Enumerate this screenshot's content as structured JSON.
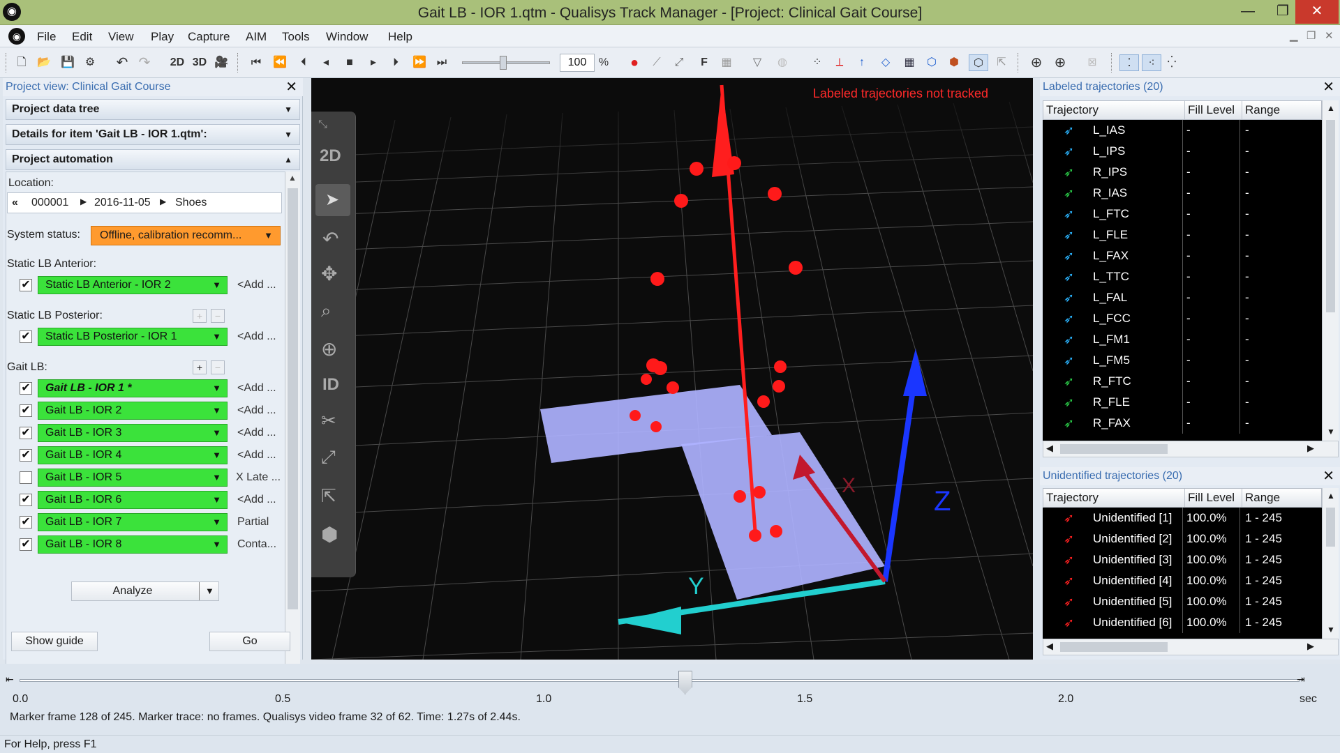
{
  "window": {
    "title": "Gait LB - IOR 1.qtm - Qualisys Track Manager - [Project: Clinical Gait Course]",
    "minimize": "—",
    "restore": "❐",
    "close": "✕"
  },
  "menu": [
    "File",
    "Edit",
    "View",
    "Play",
    "Capture",
    "AIM",
    "Tools",
    "Window",
    "Help"
  ],
  "toolbar": {
    "speed_value": "100",
    "speed_unit": "%",
    "btn_2d": "2D",
    "btn_3d": "3D",
    "icons": [
      "new-file-icon",
      "open-folder-icon",
      "save-icon",
      "settings-icon",
      "undo-icon",
      "redo-icon"
    ]
  },
  "project_view": {
    "title": "Project view: Clinical Gait Course",
    "sections": {
      "data_tree": "Project data tree",
      "details": "Details for item 'Gait LB - IOR 1.qtm':",
      "automation": "Project automation"
    },
    "location_label": "Location:",
    "location_path": [
      "«",
      "000001",
      "2016-11-05",
      "Shoes"
    ],
    "system_status_label": "System status:",
    "system_status_value": "Offline, calibration recomm...",
    "static_anterior_label": "Static LB Anterior:",
    "static_anterior": {
      "checked": true,
      "name": "Static LB Anterior - IOR 2",
      "side": "<Add ..."
    },
    "static_posterior_label": "Static LB Posterior:",
    "static_posterior": {
      "checked": true,
      "name": "Static LB Posterior - IOR 1",
      "side": "<Add ..."
    },
    "gait_label": "Gait LB:",
    "gait_items": [
      {
        "checked": true,
        "name": "Gait LB - IOR 1 *",
        "side": "<Add ...",
        "bold": true
      },
      {
        "checked": true,
        "name": "Gait LB - IOR 2",
        "side": "<Add ..."
      },
      {
        "checked": true,
        "name": "Gait LB - IOR 3",
        "side": "<Add ..."
      },
      {
        "checked": true,
        "name": "Gait LB - IOR 4",
        "side": "<Add ..."
      },
      {
        "checked": false,
        "name": "Gait LB - IOR 5",
        "side": "X Late ..."
      },
      {
        "checked": true,
        "name": "Gait LB - IOR 6",
        "side": "<Add ..."
      },
      {
        "checked": true,
        "name": "Gait LB - IOR 7",
        "side": "Partial"
      },
      {
        "checked": true,
        "name": "Gait LB - IOR 8",
        "side": "Conta..."
      }
    ],
    "analyze": "Analyze",
    "show_guide": "Show guide",
    "go": "Go"
  },
  "view3d": {
    "overlay_warning": "Labeled trajectories not tracked",
    "tool_2d": "2D",
    "tool_id": "ID",
    "axis_y": "Y",
    "axis_x": "X",
    "axis_z": "Z",
    "colors": {
      "x_axis": "#ff2a2a",
      "y_axis": "#25d6d6",
      "z_axis": "#1b3cff",
      "marker": "#ff1a1a",
      "plate": "#aab0ff"
    }
  },
  "labeled": {
    "title": "Labeled trajectories (20)",
    "columns": [
      "Trajectory",
      "Fill Level",
      "Range"
    ],
    "rows": [
      {
        "name": "L_IAS",
        "fill": "-",
        "range": "-",
        "color": "#2ab4ff"
      },
      {
        "name": "L_IPS",
        "fill": "-",
        "range": "-",
        "color": "#2ab4ff"
      },
      {
        "name": "R_IPS",
        "fill": "-",
        "range": "-",
        "color": "#2bd04a"
      },
      {
        "name": "R_IAS",
        "fill": "-",
        "range": "-",
        "color": "#2bd04a"
      },
      {
        "name": "L_FTC",
        "fill": "-",
        "range": "-",
        "color": "#2ab4ff"
      },
      {
        "name": "L_FLE",
        "fill": "-",
        "range": "-",
        "color": "#2ab4ff"
      },
      {
        "name": "L_FAX",
        "fill": "-",
        "range": "-",
        "color": "#2ab4ff"
      },
      {
        "name": "L_TTC",
        "fill": "-",
        "range": "-",
        "color": "#2ab4ff"
      },
      {
        "name": "L_FAL",
        "fill": "-",
        "range": "-",
        "color": "#2ab4ff"
      },
      {
        "name": "L_FCC",
        "fill": "-",
        "range": "-",
        "color": "#2ab4ff"
      },
      {
        "name": "L_FM1",
        "fill": "-",
        "range": "-",
        "color": "#2ab4ff"
      },
      {
        "name": "L_FM5",
        "fill": "-",
        "range": "-",
        "color": "#2ab4ff"
      },
      {
        "name": "R_FTC",
        "fill": "-",
        "range": "-",
        "color": "#2bd04a"
      },
      {
        "name": "R_FLE",
        "fill": "-",
        "range": "-",
        "color": "#2bd04a"
      },
      {
        "name": "R_FAX",
        "fill": "-",
        "range": "-",
        "color": "#2bd04a"
      }
    ]
  },
  "unidentified": {
    "title": "Unidentified trajectories (20)",
    "columns": [
      "Trajectory",
      "Fill Level",
      "Range"
    ],
    "rows": [
      {
        "name": "Unidentified [1]",
        "fill": "100.0%",
        "range": "1 - 245"
      },
      {
        "name": "Unidentified [2]",
        "fill": "100.0%",
        "range": "1 - 245"
      },
      {
        "name": "Unidentified [3]",
        "fill": "100.0%",
        "range": "1 - 245"
      },
      {
        "name": "Unidentified [4]",
        "fill": "100.0%",
        "range": "1 - 245"
      },
      {
        "name": "Unidentified [5]",
        "fill": "100.0%",
        "range": "1 - 245"
      },
      {
        "name": "Unidentified [6]",
        "fill": "100.0%",
        "range": "1 - 245"
      }
    ]
  },
  "timeline": {
    "ticks": [
      "0.0",
      "0.5",
      "1.0",
      "1.5",
      "2.0"
    ],
    "unit": "sec",
    "position_fraction": 0.52,
    "info": "Marker frame 128 of 245. Marker trace: no frames. Qualisys video frame 32 of 62. Time: 1.27s of 2.44s."
  },
  "status": "For Help, press F1"
}
